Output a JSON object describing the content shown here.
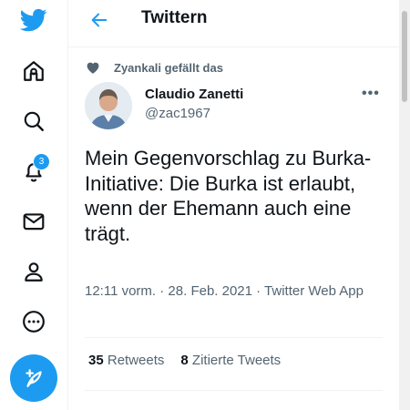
{
  "header": {
    "title": "Twittern"
  },
  "sidebar": {
    "items": [
      {
        "icon": "twitter-logo-icon"
      },
      {
        "icon": "home-icon"
      },
      {
        "icon": "search-icon"
      },
      {
        "icon": "bell-icon",
        "badge": "3"
      },
      {
        "icon": "mail-icon"
      },
      {
        "icon": "profile-icon"
      },
      {
        "icon": "more-icon"
      }
    ],
    "notification_count": "3"
  },
  "tweet": {
    "social_context": "Zyankali gefällt das",
    "author_name": "Claudio Zanetti",
    "author_handle": "@zac1967",
    "more_label": "•••",
    "text": "Mein Gegenvorschlag zu Burka-Initiative: Die Burka ist erlaubt, wenn der Ehemann auch eine trägt.",
    "timestamp": "12:11 vorm. · 28. Feb. 2021 · Twitter Web App",
    "retweets_count": "35",
    "retweets_label": "Retweets",
    "quotes_count": "8",
    "quotes_label": "Zitierte Tweets"
  },
  "colors": {
    "accent": "#1d9bf0",
    "secondary_text": "#536471",
    "primary_text": "#0f1419"
  }
}
